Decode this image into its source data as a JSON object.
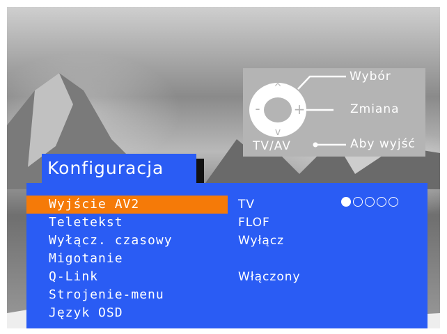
{
  "legend": {
    "select_label": "Wybór",
    "change_label": "Zmiana",
    "exit_label": "Aby wyjść",
    "source_label": "TV/AV"
  },
  "menu": {
    "title": "Konfiguracja",
    "items": [
      {
        "label": "Wyjście AV2",
        "value": "TV"
      },
      {
        "label": "Teletekst",
        "value": "FLOF"
      },
      {
        "label": "Wyłącz. czasowy",
        "value": "Wyłącz"
      },
      {
        "label": "Migotanie",
        "value": ""
      },
      {
        "label": "Q-Link",
        "value": "Włączony"
      },
      {
        "label": "Strojenie-menu",
        "value": ""
      },
      {
        "label": "Język OSD",
        "value": ""
      }
    ],
    "selected_index": 0,
    "page_indicator": {
      "total": 5,
      "current": 1
    }
  },
  "colors": {
    "menu_background": "#2a5cf4",
    "selection_highlight": "#f57a08",
    "text": "#ffffff",
    "legend_background": "#b4b4b4"
  }
}
